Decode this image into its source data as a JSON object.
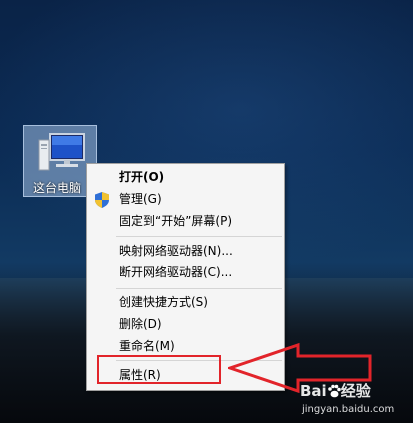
{
  "desktop": {
    "icon_label": "这台电脑"
  },
  "context_menu": {
    "items": [
      {
        "label": "打开(O)",
        "bold": true
      },
      {
        "label": "管理(G)",
        "icon": "uac-shield-icon"
      },
      {
        "label": "固定到“开始”屏幕(P)"
      },
      {
        "label": "映射网络驱动器(N)..."
      },
      {
        "label": "断开网络驱动器(C)..."
      },
      {
        "label": "创建快捷方式(S)"
      },
      {
        "label": "删除(D)"
      },
      {
        "label": "重命名(M)"
      },
      {
        "label": "属性(R)"
      }
    ]
  },
  "annotation": {
    "highlight_color": "#e2242a"
  },
  "watermark": {
    "brand_a": "Bai",
    "brand_b": "经验",
    "url": "jingyan.baidu.com"
  }
}
